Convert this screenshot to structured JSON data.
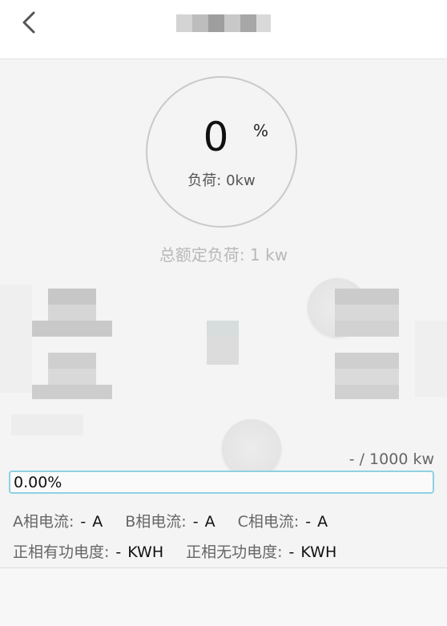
{
  "gauge": {
    "value": "0",
    "unit": "%",
    "load_label": "负荷: 0kw"
  },
  "rated_load": "总额定负荷: 1 kw",
  "max_load": "- / 1000 kw",
  "percent": "0.00%",
  "currents": [
    {
      "label": "A相电流:",
      "value": "-",
      "unit": "A"
    },
    {
      "label": "B相电流:",
      "value": "-",
      "unit": "A"
    },
    {
      "label": "C相电流:",
      "value": "-",
      "unit": "A"
    }
  ],
  "energy": [
    {
      "label": "正相有功电度:",
      "value": "-",
      "unit": "KWH"
    },
    {
      "label": "正相无功电度:",
      "value": "-",
      "unit": "KWH"
    }
  ],
  "colors": {
    "accent_border": "#8fd0e3",
    "ring": "#c9c9c9",
    "muted_text": "#b8b8b8"
  },
  "icons": {
    "back": "chevron-left-icon"
  }
}
